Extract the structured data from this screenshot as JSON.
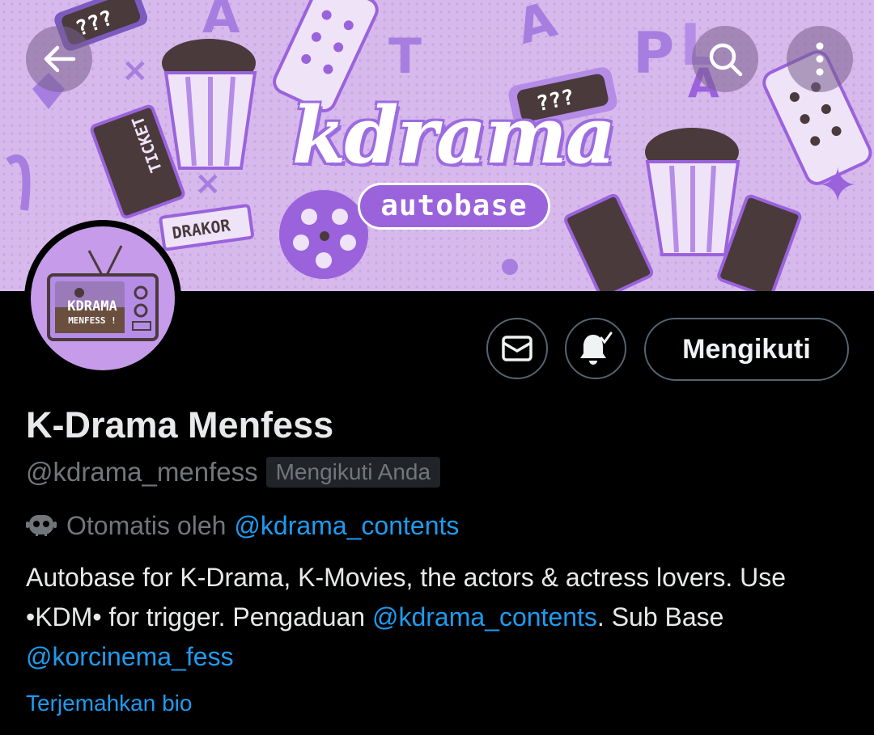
{
  "banner": {
    "title": "kdrama",
    "subtitle": "autobase",
    "sticker_labels": {
      "question_marks": "???",
      "plot": "PLOT",
      "drakor": "DRAKOR",
      "ticket": "TICKET"
    },
    "colors": {
      "background": "#d7b9ec",
      "accent": "#9a63dc",
      "dark": "#4a3a3c"
    }
  },
  "nav": {
    "back_icon": "arrow-left-icon",
    "search_icon": "search-icon",
    "more_icon": "more-vertical-icon"
  },
  "avatar": {
    "line1": "KDRAMA",
    "line2": "MENFESS !"
  },
  "actions": {
    "message_icon": "mail-icon",
    "notifications_icon": "bell-check-icon",
    "follow_label": "Mengikuti"
  },
  "profile": {
    "display_name": "K-Drama Menfess",
    "handle": "@kdrama_menfess",
    "follows_you": "Mengikuti Anda",
    "automated_prefix": "Otomatis oleh",
    "automated_account": "@kdrama_contents",
    "bio": {
      "part1": "Autobase for K-Drama, K-Movies, the actors & actress lovers. Use •KDM• for trigger. Pengaduan ",
      "mention1": "@kdrama_contents",
      "part2": ". Sub Base ",
      "mention2": "@korcinema_fess"
    },
    "translate_label": "Terjemahkan bio"
  },
  "theme": {
    "background": "#000000",
    "text": "#e7e9ea",
    "secondary": "#71767b",
    "link": "#1d9bf0",
    "border": "#536471"
  }
}
